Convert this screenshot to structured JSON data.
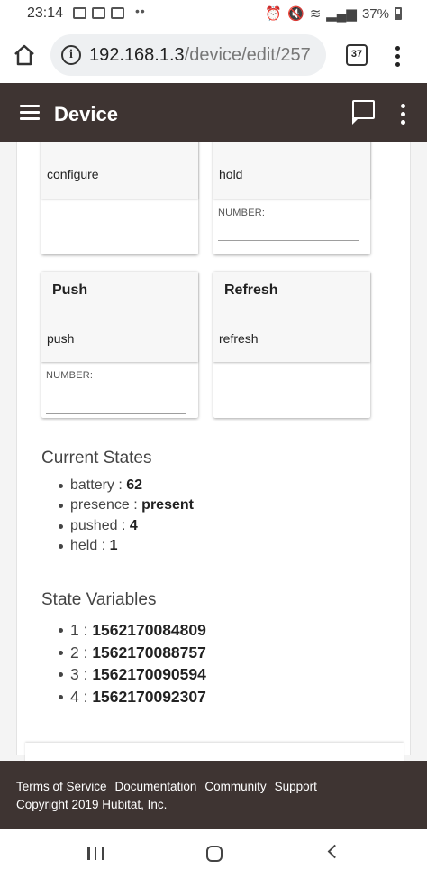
{
  "status_bar": {
    "time": "23:14",
    "battery_percent": "37%"
  },
  "browser": {
    "url_host": "192.168.1.3",
    "url_path": "/device/edit/257",
    "tab_count": "37"
  },
  "app_bar": {
    "title": "Device"
  },
  "commands": [
    {
      "title": "",
      "method": "configure",
      "param_label": ""
    },
    {
      "title": "",
      "method": "hold",
      "param_label": "NUMBER:"
    },
    {
      "title": "Push",
      "method": "push",
      "param_label": "NUMBER:"
    },
    {
      "title": "Refresh",
      "method": "refresh",
      "param_label": ""
    }
  ],
  "current_states": {
    "heading": "Current States",
    "items": [
      {
        "key": "battery",
        "value": "62"
      },
      {
        "key": "presence",
        "value": "present"
      },
      {
        "key": "pushed",
        "value": "4"
      },
      {
        "key": "held",
        "value": "1"
      }
    ]
  },
  "state_variables": {
    "heading": "State Variables",
    "items": [
      {
        "key": "1",
        "value": "1562170084809"
      },
      {
        "key": "2",
        "value": "1562170088757"
      },
      {
        "key": "3",
        "value": "1562170090594"
      },
      {
        "key": "4",
        "value": "1562170092307"
      }
    ]
  },
  "footer": {
    "links": [
      "Terms of Service",
      "Documentation",
      "Community",
      "Support"
    ],
    "copyright": "Copyright 2019 Hubitat, Inc."
  },
  "colors": {
    "app_bar_bg": "#3e3432",
    "footer_bg": "#3e3432"
  }
}
